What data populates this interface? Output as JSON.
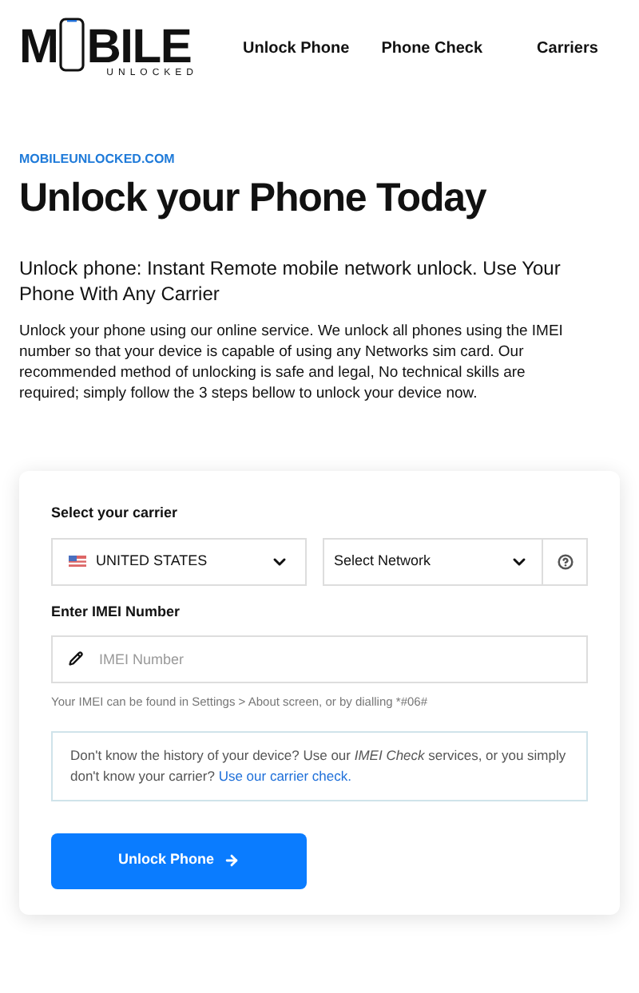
{
  "header": {
    "logo": {
      "left": "M",
      "right": "BILE",
      "tagline": "UNLOCKED"
    },
    "nav": [
      {
        "label": "Unlock Phone"
      },
      {
        "label": "Phone Check"
      },
      {
        "label": "Carriers"
      }
    ]
  },
  "hero": {
    "eyebrow": "MOBILEUNLOCKED.COM",
    "title": "Unlock your Phone Today",
    "lead": "Unlock phone: Instant Remote mobile network unlock. Use Your Phone With Any Carrier",
    "body": "Unlock your phone using our online service. We unlock all phones using the IMEI number so that your device is capable of using any Networks sim card. Our recommended method of unlocking is safe and legal, No technical skills are required; simply follow the 3 steps bellow to unlock your device now."
  },
  "form": {
    "carrier_label": "Select your carrier",
    "country": "UNITED STATES",
    "network": "Select Network",
    "imei_label": "Enter IMEI Number",
    "imei_placeholder": "IMEI Number",
    "hint": "Your IMEI can be found in Settings > About screen, or by dialling *#06#",
    "note": "Don't know the history of your device? Use our *IMEI Check* services, or you simply don't know your carrier?",
    "note_link": "Use our carrier check.",
    "button": "Unlock Phone"
  }
}
